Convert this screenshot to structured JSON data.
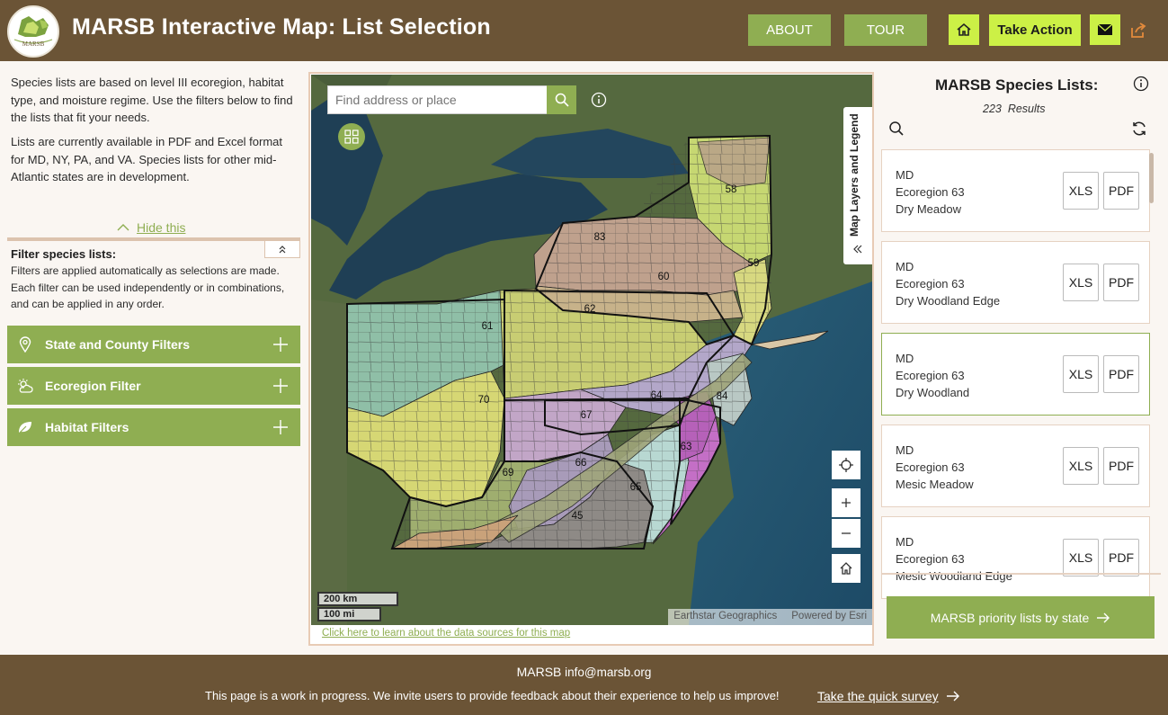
{
  "header": {
    "logo_text": "MARSB",
    "title": "MARSB Interactive Map: List Selection",
    "about_label": "ABOUT",
    "tour_label": "TOUR",
    "take_action_label": "Take Action",
    "colors": {
      "bg": "#6b5436",
      "green_button": "#8fae52",
      "lime_button": "#ccf046"
    }
  },
  "intro": {
    "p1": "Species lists are based on level III ecoregion, habitat type, and moisture regime. Use the filters below to find the lists that fit your needs.",
    "p2": "Lists are currently available in PDF and Excel format for MD, NY, PA, and VA. Species lists for other mid-Atlantic states are in development.",
    "hide_label": "Hide this"
  },
  "filters": {
    "title": "Filter species lists:",
    "description": "Filters are applied automatically as selections are made. Each filter can be used independently or in combinations, and can be applied in any order.",
    "accordions": [
      {
        "label": "State and County Filters",
        "icon": "location-pin-icon"
      },
      {
        "label": "Ecoregion Filter",
        "icon": "weather-sun-cloud-icon"
      },
      {
        "label": "Habitat Filters",
        "icon": "leaf-icon"
      }
    ]
  },
  "map": {
    "search_placeholder": "Find address or place",
    "layers_tab_label": "Map Layers and Legend",
    "ecoregion_labels": [
      "58",
      "83",
      "60",
      "59",
      "62",
      "61",
      "70",
      "64",
      "84",
      "67",
      "63",
      "66",
      "69",
      "65",
      "45"
    ],
    "scale_km": "200 km",
    "scale_mi": "100 mi",
    "attribution_left": "Earthstar Geographics",
    "attribution_right": "Powered by Esri",
    "data_sources_link": "Click here to learn about the data sources for this map"
  },
  "species_lists": {
    "title": "MARSB Species Lists:",
    "count": "223",
    "count_suffix": "Results",
    "xls_label": "XLS",
    "pdf_label": "PDF",
    "items": [
      {
        "state": "MD",
        "ecoregion": "Ecoregion 63",
        "habitat": "Dry Meadow"
      },
      {
        "state": "MD",
        "ecoregion": "Ecoregion 63",
        "habitat": "Dry Woodland Edge"
      },
      {
        "state": "MD",
        "ecoregion": "Ecoregion 63",
        "habitat": "Dry Woodland"
      },
      {
        "state": "MD",
        "ecoregion": "Ecoregion 63",
        "habitat": "Mesic Meadow"
      },
      {
        "state": "MD",
        "ecoregion": "Ecoregion 63",
        "habitat": "Mesic Woodland Edge"
      }
    ],
    "priority_button": "MARSB priority lists by state"
  },
  "footer": {
    "org": "MARSB",
    "email": "info@marsb.org",
    "message": "This page is a work in progress. We invite users to provide feedback about their experience to help us improve!",
    "survey_link": "Take the quick survey"
  }
}
